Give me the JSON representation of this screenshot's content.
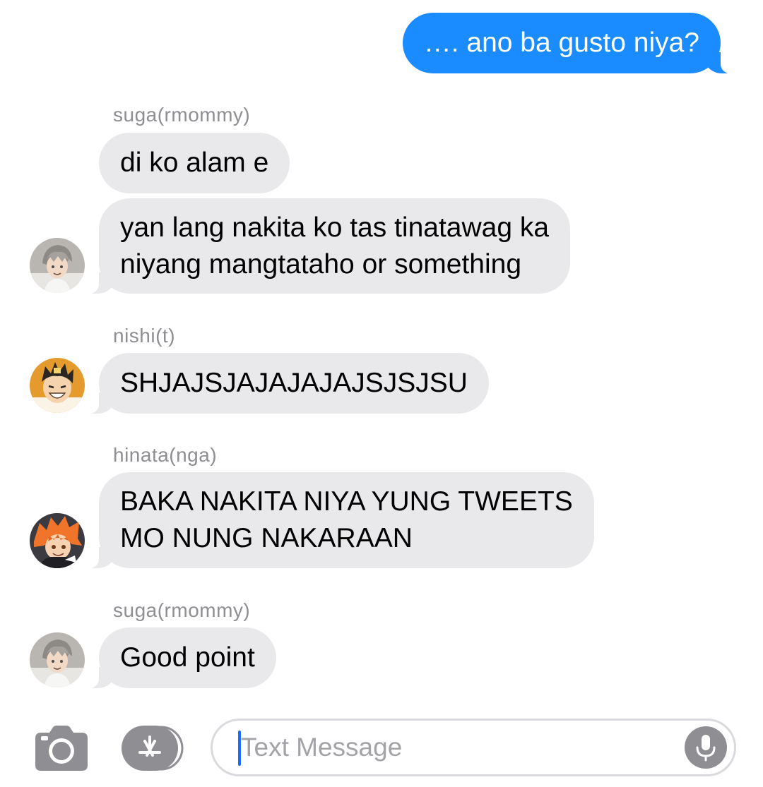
{
  "conversation": {
    "messages": [
      {
        "direction": "outgoing",
        "text": "…. ano ba gusto niya?"
      },
      {
        "direction": "incoming",
        "sender": "suga(rmommy)",
        "text": "di ko alam e"
      },
      {
        "direction": "incoming",
        "text_lines": [
          "yan lang nakita ko tas tinatawag ka",
          "niyang mangtataho or something"
        ]
      },
      {
        "direction": "incoming",
        "sender": "nishi(t)",
        "text": "SHJAJSJAJAJAJAJSJSJSU"
      },
      {
        "direction": "incoming",
        "sender": "hinata(nga)",
        "text_lines": [
          "BAKA NAKITA NIYA YUNG TWEETS",
          "MO NUNG NAKARAAN"
        ]
      },
      {
        "direction": "incoming",
        "sender": "suga(rmommy)",
        "text": "Good point"
      }
    ]
  },
  "input_bar": {
    "placeholder": "Text Message",
    "icons": [
      "camera-icon",
      "app-store-icon",
      "microphone-icon"
    ]
  },
  "colors": {
    "outgoing_bubble": "#1a8cff",
    "incoming_bubble": "#e9e9eb",
    "sender_label": "#8e8e93",
    "caret": "#1a6cff"
  }
}
